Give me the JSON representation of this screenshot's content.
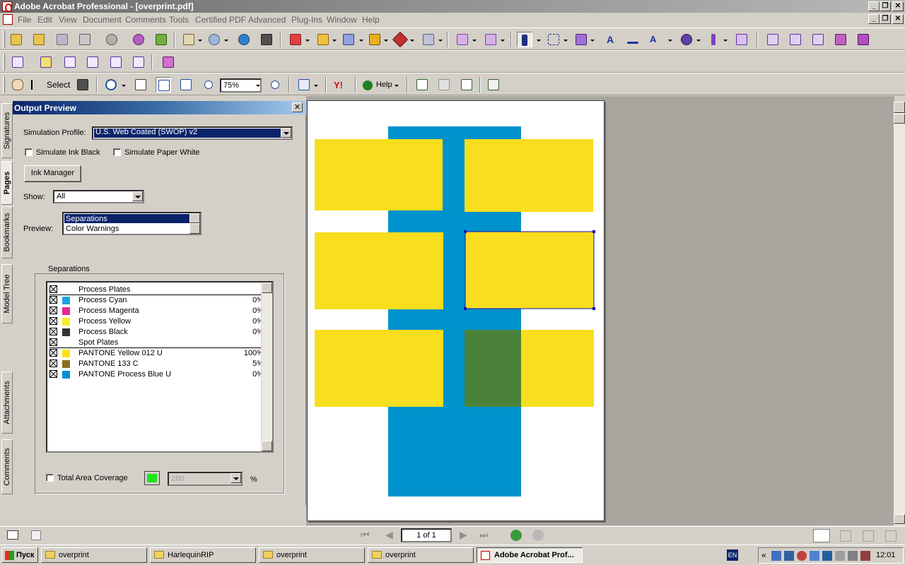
{
  "window": {
    "title": "Adobe Acrobat Professional - [overprint.pdf]",
    "controls": [
      "_",
      "❐",
      "✕"
    ]
  },
  "menu": [
    "File",
    "Edit",
    "View",
    "Document",
    "Comments",
    "Tools",
    "Certified PDF",
    "Advanced",
    "Plug-Ins",
    "Window",
    "Help"
  ],
  "toolbar": {
    "select_label": "Select",
    "zoom_value": "75%",
    "help_label": "Help",
    "yahoo_label": "Y!"
  },
  "side_tabs": [
    "Signatures",
    "Pages",
    "Bookmarks",
    "Model Tree",
    "Attachments",
    "Comments"
  ],
  "output_preview": {
    "title": "Output Preview",
    "simulation_profile_label": "Simulation Profile:",
    "simulation_profile_value": "U.S. Web Coated (SWOP) v2",
    "simulate_ink_black": "Simulate Ink Black",
    "simulate_paper_white": "Simulate Paper White",
    "ink_manager": "Ink Manager",
    "show_label": "Show:",
    "show_value": "All",
    "preview_label": "Preview:",
    "preview_options": [
      "Separations",
      "Color Warnings"
    ],
    "separations_group": "Separations",
    "separations": [
      {
        "name": "Process Plates",
        "pct": "",
        "swatch": null,
        "header": true
      },
      {
        "name": "Process Cyan",
        "pct": "0%",
        "swatch": "#1ca3e0",
        "header": false
      },
      {
        "name": "Process Magenta",
        "pct": "0%",
        "swatch": "#e5298f",
        "header": false
      },
      {
        "name": "Process Yellow",
        "pct": "0%",
        "swatch": "#f9ee2a",
        "header": false
      },
      {
        "name": "Process Black",
        "pct": "0%",
        "swatch": "#333333",
        "header": false
      },
      {
        "name": "Spot Plates",
        "pct": "",
        "swatch": null,
        "header": true
      },
      {
        "name": "PANTONE Yellow 012 U",
        "pct": "100%",
        "swatch": "#ffe014",
        "header": false
      },
      {
        "name": "PANTONE 133 C",
        "pct": "5%",
        "swatch": "#8c6d1f",
        "header": false
      },
      {
        "name": "PANTONE Process Blue U",
        "pct": "0%",
        "swatch": "#0090cf",
        "header": false
      }
    ],
    "total_area_coverage": "Total Area Coverage",
    "coverage_value": "280",
    "coverage_unit": "%",
    "coverage_color": "#18e818"
  },
  "document": {
    "colors": {
      "blue": "#0092cc",
      "yellow": "#f8de1e",
      "green": "#4b823a"
    }
  },
  "navigation": {
    "page_field": "1 of 1"
  },
  "taskbar": {
    "start": "Пуск",
    "tasks": [
      "overprint",
      "HarlequinRIP",
      "overprint",
      "overprint",
      "Adobe Acrobat Prof..."
    ],
    "lang": "EN",
    "clock": "12:01"
  }
}
